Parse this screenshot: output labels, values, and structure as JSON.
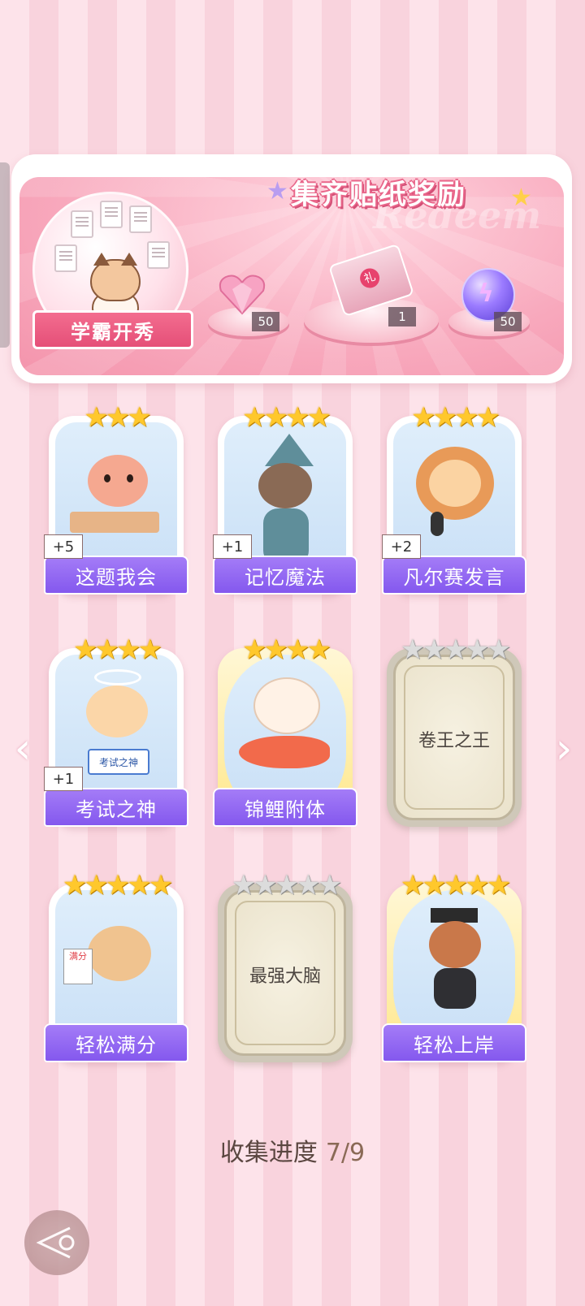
{
  "banner": {
    "title": "集齐贴纸奖励",
    "watermark": "Redeem",
    "feature_label": "学霸开秀",
    "rewards": [
      {
        "icon": "pink-heart-gem-icon",
        "qty": "50"
      },
      {
        "icon": "gift-box-bundle-icon",
        "qty": "1"
      },
      {
        "icon": "purple-lightning-orb-icon",
        "qty": "50"
      }
    ]
  },
  "stickers": [
    {
      "name": "这题我会",
      "stars": 3,
      "count": "+5",
      "unlocked": true
    },
    {
      "name": "记忆魔法",
      "stars": 4,
      "count": "+1",
      "unlocked": true
    },
    {
      "name": "凡尔赛发言",
      "stars": 4,
      "count": "+2",
      "unlocked": true
    },
    {
      "name": "考试之神",
      "stars": 4,
      "count": "+1",
      "unlocked": true,
      "sign": "考试之神"
    },
    {
      "name": "锦鲤附体",
      "stars": 4,
      "count": "",
      "unlocked": true
    },
    {
      "name": "卷王之王",
      "stars": 5,
      "count": "",
      "unlocked": false
    },
    {
      "name": "轻松满分",
      "stars": 5,
      "count": "",
      "unlocked": true,
      "sign": "满分"
    },
    {
      "name": "最强大脑",
      "stars": 5,
      "count": "",
      "unlocked": false
    },
    {
      "name": "轻松上岸",
      "stars": 5,
      "count": "",
      "unlocked": true
    }
  ],
  "progress": {
    "label": "收集进度",
    "value": "7/9"
  },
  "colors": {
    "accent_purple": "#8458ee",
    "banner_pink": "#f494ac",
    "star_gold": "#ffc82c"
  }
}
